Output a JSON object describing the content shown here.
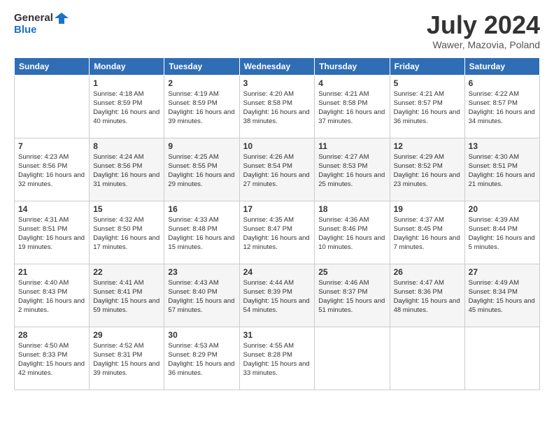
{
  "header": {
    "logo_line1": "General",
    "logo_line2": "Blue",
    "month": "July 2024",
    "location": "Wawer, Mazovia, Poland"
  },
  "days_of_week": [
    "Sunday",
    "Monday",
    "Tuesday",
    "Wednesday",
    "Thursday",
    "Friday",
    "Saturday"
  ],
  "weeks": [
    [
      {
        "day": "",
        "sunrise": "",
        "sunset": "",
        "daylight": ""
      },
      {
        "day": "1",
        "sunrise": "Sunrise: 4:18 AM",
        "sunset": "Sunset: 8:59 PM",
        "daylight": "Daylight: 16 hours and 40 minutes."
      },
      {
        "day": "2",
        "sunrise": "Sunrise: 4:19 AM",
        "sunset": "Sunset: 8:59 PM",
        "daylight": "Daylight: 16 hours and 39 minutes."
      },
      {
        "day": "3",
        "sunrise": "Sunrise: 4:20 AM",
        "sunset": "Sunset: 8:58 PM",
        "daylight": "Daylight: 16 hours and 38 minutes."
      },
      {
        "day": "4",
        "sunrise": "Sunrise: 4:21 AM",
        "sunset": "Sunset: 8:58 PM",
        "daylight": "Daylight: 16 hours and 37 minutes."
      },
      {
        "day": "5",
        "sunrise": "Sunrise: 4:21 AM",
        "sunset": "Sunset: 8:57 PM",
        "daylight": "Daylight: 16 hours and 36 minutes."
      },
      {
        "day": "6",
        "sunrise": "Sunrise: 4:22 AM",
        "sunset": "Sunset: 8:57 PM",
        "daylight": "Daylight: 16 hours and 34 minutes."
      }
    ],
    [
      {
        "day": "7",
        "sunrise": "Sunrise: 4:23 AM",
        "sunset": "Sunset: 8:56 PM",
        "daylight": "Daylight: 16 hours and 32 minutes."
      },
      {
        "day": "8",
        "sunrise": "Sunrise: 4:24 AM",
        "sunset": "Sunset: 8:56 PM",
        "daylight": "Daylight: 16 hours and 31 minutes."
      },
      {
        "day": "9",
        "sunrise": "Sunrise: 4:25 AM",
        "sunset": "Sunset: 8:55 PM",
        "daylight": "Daylight: 16 hours and 29 minutes."
      },
      {
        "day": "10",
        "sunrise": "Sunrise: 4:26 AM",
        "sunset": "Sunset: 8:54 PM",
        "daylight": "Daylight: 16 hours and 27 minutes."
      },
      {
        "day": "11",
        "sunrise": "Sunrise: 4:27 AM",
        "sunset": "Sunset: 8:53 PM",
        "daylight": "Daylight: 16 hours and 25 minutes."
      },
      {
        "day": "12",
        "sunrise": "Sunrise: 4:29 AM",
        "sunset": "Sunset: 8:52 PM",
        "daylight": "Daylight: 16 hours and 23 minutes."
      },
      {
        "day": "13",
        "sunrise": "Sunrise: 4:30 AM",
        "sunset": "Sunset: 8:51 PM",
        "daylight": "Daylight: 16 hours and 21 minutes."
      }
    ],
    [
      {
        "day": "14",
        "sunrise": "Sunrise: 4:31 AM",
        "sunset": "Sunset: 8:51 PM",
        "daylight": "Daylight: 16 hours and 19 minutes."
      },
      {
        "day": "15",
        "sunrise": "Sunrise: 4:32 AM",
        "sunset": "Sunset: 8:50 PM",
        "daylight": "Daylight: 16 hours and 17 minutes."
      },
      {
        "day": "16",
        "sunrise": "Sunrise: 4:33 AM",
        "sunset": "Sunset: 8:48 PM",
        "daylight": "Daylight: 16 hours and 15 minutes."
      },
      {
        "day": "17",
        "sunrise": "Sunrise: 4:35 AM",
        "sunset": "Sunset: 8:47 PM",
        "daylight": "Daylight: 16 hours and 12 minutes."
      },
      {
        "day": "18",
        "sunrise": "Sunrise: 4:36 AM",
        "sunset": "Sunset: 8:46 PM",
        "daylight": "Daylight: 16 hours and 10 minutes."
      },
      {
        "day": "19",
        "sunrise": "Sunrise: 4:37 AM",
        "sunset": "Sunset: 8:45 PM",
        "daylight": "Daylight: 16 hours and 7 minutes."
      },
      {
        "day": "20",
        "sunrise": "Sunrise: 4:39 AM",
        "sunset": "Sunset: 8:44 PM",
        "daylight": "Daylight: 16 hours and 5 minutes."
      }
    ],
    [
      {
        "day": "21",
        "sunrise": "Sunrise: 4:40 AM",
        "sunset": "Sunset: 8:43 PM",
        "daylight": "Daylight: 16 hours and 2 minutes."
      },
      {
        "day": "22",
        "sunrise": "Sunrise: 4:41 AM",
        "sunset": "Sunset: 8:41 PM",
        "daylight": "Daylight: 15 hours and 59 minutes."
      },
      {
        "day": "23",
        "sunrise": "Sunrise: 4:43 AM",
        "sunset": "Sunset: 8:40 PM",
        "daylight": "Daylight: 15 hours and 57 minutes."
      },
      {
        "day": "24",
        "sunrise": "Sunrise: 4:44 AM",
        "sunset": "Sunset: 8:39 PM",
        "daylight": "Daylight: 15 hours and 54 minutes."
      },
      {
        "day": "25",
        "sunrise": "Sunrise: 4:46 AM",
        "sunset": "Sunset: 8:37 PM",
        "daylight": "Daylight: 15 hours and 51 minutes."
      },
      {
        "day": "26",
        "sunrise": "Sunrise: 4:47 AM",
        "sunset": "Sunset: 8:36 PM",
        "daylight": "Daylight: 15 hours and 48 minutes."
      },
      {
        "day": "27",
        "sunrise": "Sunrise: 4:49 AM",
        "sunset": "Sunset: 8:34 PM",
        "daylight": "Daylight: 15 hours and 45 minutes."
      }
    ],
    [
      {
        "day": "28",
        "sunrise": "Sunrise: 4:50 AM",
        "sunset": "Sunset: 8:33 PM",
        "daylight": "Daylight: 15 hours and 42 minutes."
      },
      {
        "day": "29",
        "sunrise": "Sunrise: 4:52 AM",
        "sunset": "Sunset: 8:31 PM",
        "daylight": "Daylight: 15 hours and 39 minutes."
      },
      {
        "day": "30",
        "sunrise": "Sunrise: 4:53 AM",
        "sunset": "Sunset: 8:29 PM",
        "daylight": "Daylight: 15 hours and 36 minutes."
      },
      {
        "day": "31",
        "sunrise": "Sunrise: 4:55 AM",
        "sunset": "Sunset: 8:28 PM",
        "daylight": "Daylight: 15 hours and 33 minutes."
      },
      {
        "day": "",
        "sunrise": "",
        "sunset": "",
        "daylight": ""
      },
      {
        "day": "",
        "sunrise": "",
        "sunset": "",
        "daylight": ""
      },
      {
        "day": "",
        "sunrise": "",
        "sunset": "",
        "daylight": ""
      }
    ]
  ]
}
